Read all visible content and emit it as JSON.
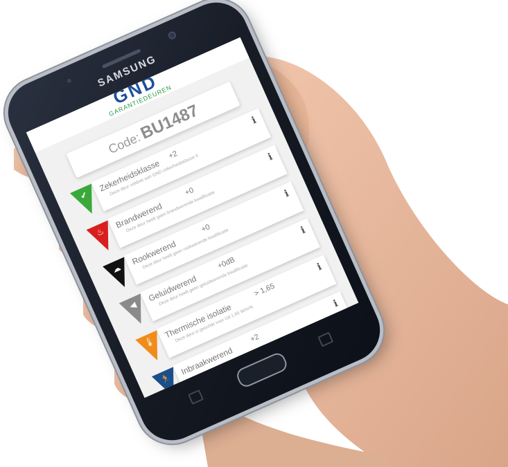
{
  "device": {
    "brand": "SAMSUNG"
  },
  "app": {
    "logo_text": "GND",
    "logo_subtitle": "GARANTIEDEUREN",
    "code_label": "Code:",
    "code_value": "BU1487"
  },
  "items": [
    {
      "title": "Zekerheidsklasse",
      "value": "+2",
      "description": "Deze deur voldoet aan GND-zekerheidsklasse II",
      "color": "#3aa83a",
      "icon": "check-icon"
    },
    {
      "title": "Brandwerend",
      "value": "+0",
      "description": "Deze deur heeft geen brandwerende kwalificatie",
      "color": "#d81e1e",
      "icon": "flame-icon"
    },
    {
      "title": "Rookwerend",
      "value": "+0",
      "description": "Deze deur heeft geen rookwerende kwalificatie",
      "color": "#111111",
      "icon": "smoke-icon"
    },
    {
      "title": "Geluidwerend",
      "value": "+0dB",
      "description": "Deze deur heeft geen geluidwerende kwalificatie",
      "color": "#8a8a8a",
      "icon": "speaker-icon"
    },
    {
      "title": "Thermische isolatie",
      "value": "> 1,65",
      "description": "Deze deur is geschikt voor Ud 1,65 W/m²K",
      "color": "#f08c1a",
      "icon": "thermometer-icon"
    },
    {
      "title": "Inbraakwerend",
      "value": "+2",
      "description": "",
      "color": "#1b4f8a",
      "icon": "burglar-icon"
    }
  ],
  "info_glyph": "i"
}
